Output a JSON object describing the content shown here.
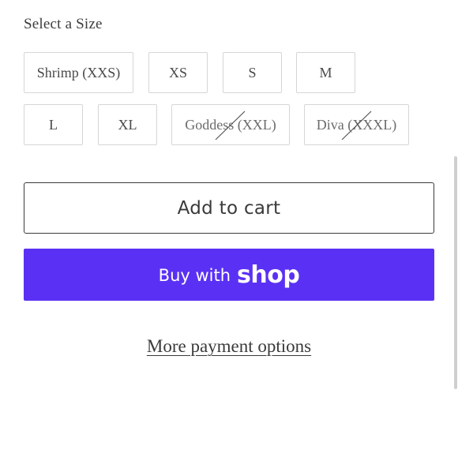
{
  "size_selector": {
    "label": "Select a Size",
    "options": [
      {
        "label": "Shrimp (XXS)",
        "available": true
      },
      {
        "label": "XS",
        "available": true
      },
      {
        "label": "S",
        "available": true
      },
      {
        "label": "M",
        "available": true
      },
      {
        "label": "L",
        "available": true
      },
      {
        "label": "XL",
        "available": true
      },
      {
        "label": "Goddess (XXL)",
        "available": false
      },
      {
        "label": "Diva (XXXL)",
        "available": false
      }
    ]
  },
  "actions": {
    "add_to_cart": "Add to cart",
    "buy_with_prefix": "Buy with",
    "buy_with_brand": "shop",
    "more_payment_options": "More payment options"
  },
  "colors": {
    "shop_pay_purple": "#5a31f4",
    "text_dark": "#3a3a3a",
    "border_light": "#d6d6d6"
  }
}
